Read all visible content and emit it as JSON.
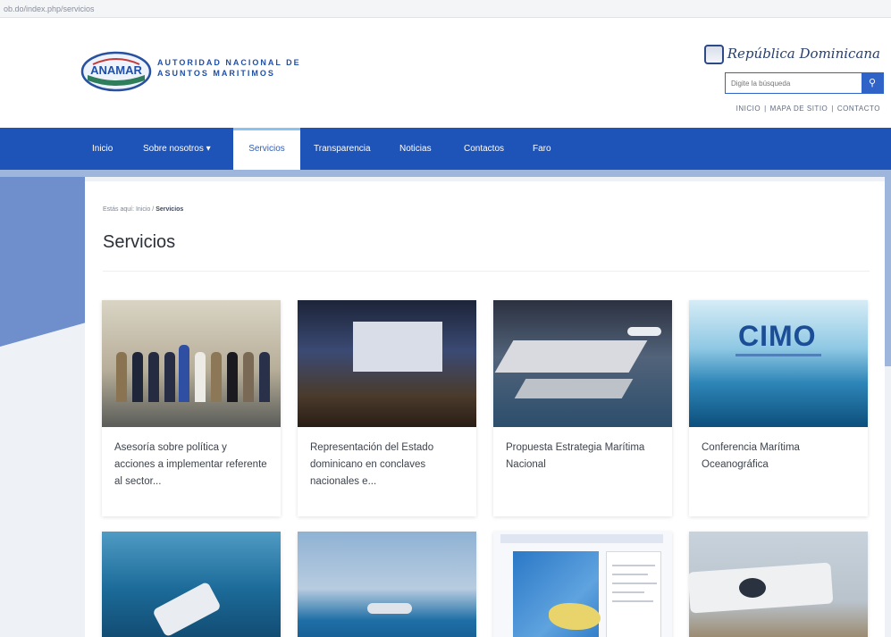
{
  "browser": {
    "url": "ob.do/index.php/servicios"
  },
  "header": {
    "logo_text": "AUTORIDAD NACIONAL DE ASUNTOS MARITIMOS",
    "logo_acronym": "ANAMAR",
    "republica": "República Dominicana",
    "search_placeholder": "Digite la búsqueda",
    "links": [
      "INICIO",
      "MAPA DE SITIO",
      "CONTACTO"
    ]
  },
  "nav": {
    "items": [
      "Inicio",
      "Sobre nosotros ▾",
      "Servicios",
      "Transparencia",
      "Noticias",
      "Contactos",
      "Faro"
    ],
    "active": "Servicios"
  },
  "breadcrumb": {
    "prefix": "Estás aquí:",
    "home": "Inicio",
    "sep": "/",
    "current": "Servicios"
  },
  "page_title": "Servicios",
  "cards": [
    {
      "title": "Asesoría sobre política y acciones a implementar referente al sector...",
      "image": "group-photo"
    },
    {
      "title": "Representación del Estado dominicano en conclaves nacionales e...",
      "image": "conference-hall"
    },
    {
      "title": "Propuesta Estrategia Marítima Nacional",
      "image": "port-render"
    },
    {
      "title": "Conferencia Marítima Oceanográfica",
      "image": "cimo-banner",
      "image_text": "CIMO"
    },
    {
      "title": "",
      "image": "boat-at-sea"
    },
    {
      "title": "",
      "image": "ship-horizon"
    },
    {
      "title": "",
      "image": "map-document"
    },
    {
      "title": "",
      "image": "patrol-boat"
    }
  ],
  "colors": {
    "nav_bg": "#1e53b8",
    "accent": "#2f63c7",
    "band": "#9fb6dc"
  }
}
